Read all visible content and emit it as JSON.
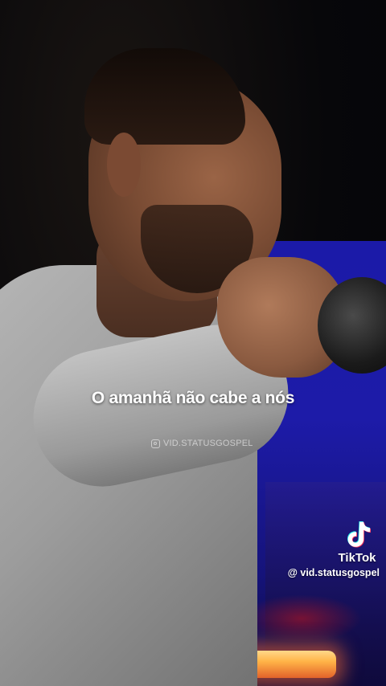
{
  "video": {
    "caption": "O amanhã não cabe a nós",
    "watermark": "VID.STATUSGOSPEL",
    "watermark_icon": "instagram-icon"
  },
  "tiktok": {
    "brand": "TikTok",
    "handle": "@ vid.statusgospel",
    "logo_icon": "tiktok-logo-icon"
  },
  "colors": {
    "background_blue": "#1d1ba8",
    "stage_light": "#ffb347",
    "shirt_gray": "#9d9d9d"
  }
}
